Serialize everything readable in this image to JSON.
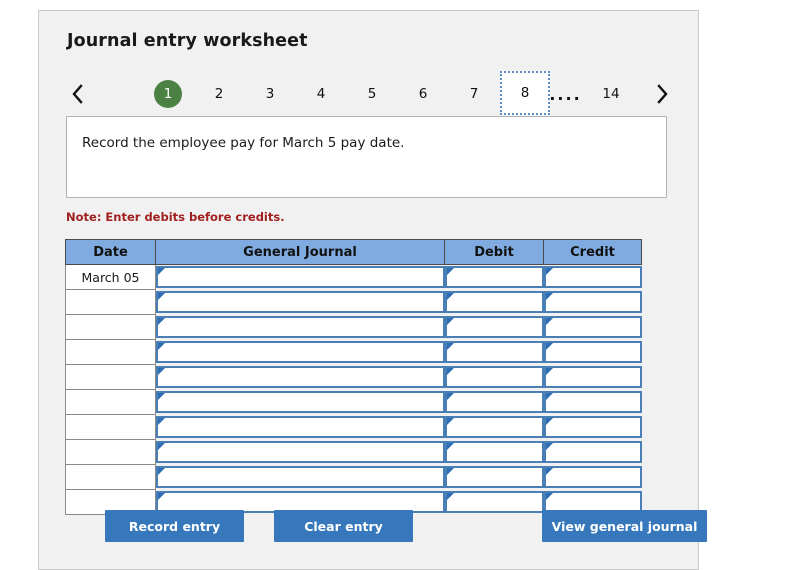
{
  "page": {
    "title": "Journal entry worksheet"
  },
  "pager": {
    "prev_icon": "chevron-left-icon",
    "next_icon": "chevron-right-icon",
    "ellipsis": "....",
    "items": [
      {
        "label": "1",
        "state": "current"
      },
      {
        "label": "2",
        "state": "normal"
      },
      {
        "label": "3",
        "state": "normal"
      },
      {
        "label": "4",
        "state": "normal"
      },
      {
        "label": "5",
        "state": "normal"
      },
      {
        "label": "6",
        "state": "normal"
      },
      {
        "label": "7",
        "state": "normal"
      },
      {
        "label": "8",
        "state": "focused"
      },
      {
        "label": "14",
        "state": "normal"
      }
    ]
  },
  "prompt": {
    "text": "Record the employee pay for March 5 pay date."
  },
  "note": {
    "text": "Note: Enter debits before credits."
  },
  "table": {
    "headers": [
      "Date",
      "General Journal",
      "Debit",
      "Credit"
    ],
    "rows": [
      {
        "date": "March 05",
        "general_journal": "",
        "debit": "",
        "credit": ""
      },
      {
        "date": "",
        "general_journal": "",
        "debit": "",
        "credit": ""
      },
      {
        "date": "",
        "general_journal": "",
        "debit": "",
        "credit": ""
      },
      {
        "date": "",
        "general_journal": "",
        "debit": "",
        "credit": ""
      },
      {
        "date": "",
        "general_journal": "",
        "debit": "",
        "credit": ""
      },
      {
        "date": "",
        "general_journal": "",
        "debit": "",
        "credit": ""
      },
      {
        "date": "",
        "general_journal": "",
        "debit": "",
        "credit": ""
      },
      {
        "date": "",
        "general_journal": "",
        "debit": "",
        "credit": ""
      },
      {
        "date": "",
        "general_journal": "",
        "debit": "",
        "credit": ""
      },
      {
        "date": "",
        "general_journal": "",
        "debit": "",
        "credit": ""
      }
    ]
  },
  "buttons": {
    "record": "Record entry",
    "clear": "Clear entry",
    "view": "View general journal"
  },
  "colors": {
    "panel_bg": "#f1f1f1",
    "header_blue": "#80abe0",
    "button_blue": "#3778bc",
    "current_green": "#4b8244",
    "note_red": "#a12020",
    "cell_border_blue": "#4a7fb5",
    "focus_dotted_blue": "#5b8fc9"
  }
}
